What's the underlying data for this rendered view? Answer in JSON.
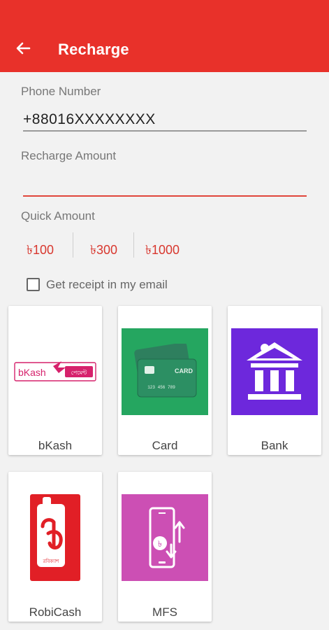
{
  "header": {
    "title": "Recharge",
    "back_icon": "arrow-left-icon",
    "color": "#e8312a"
  },
  "phone": {
    "label": "Phone Number",
    "value": "+88016XXXXXXXX"
  },
  "amount": {
    "label": "Recharge Amount",
    "value": ""
  },
  "quick": {
    "label": "Quick Amount",
    "options": [
      "৳100",
      "৳300",
      "৳1000"
    ]
  },
  "receipt": {
    "label": "Get receipt in my email",
    "checked": false
  },
  "methods": [
    {
      "label": "bKash",
      "logo_text": "bKash",
      "logo_subtext": "পেমেন্ট"
    },
    {
      "label": "Card",
      "card_text": "CARD",
      "card_number": "123 456 789"
    },
    {
      "label": "Bank"
    },
    {
      "label": "RobiCash",
      "logo_subtext": "রবিক্যাশ"
    },
    {
      "label": "MFS"
    }
  ]
}
